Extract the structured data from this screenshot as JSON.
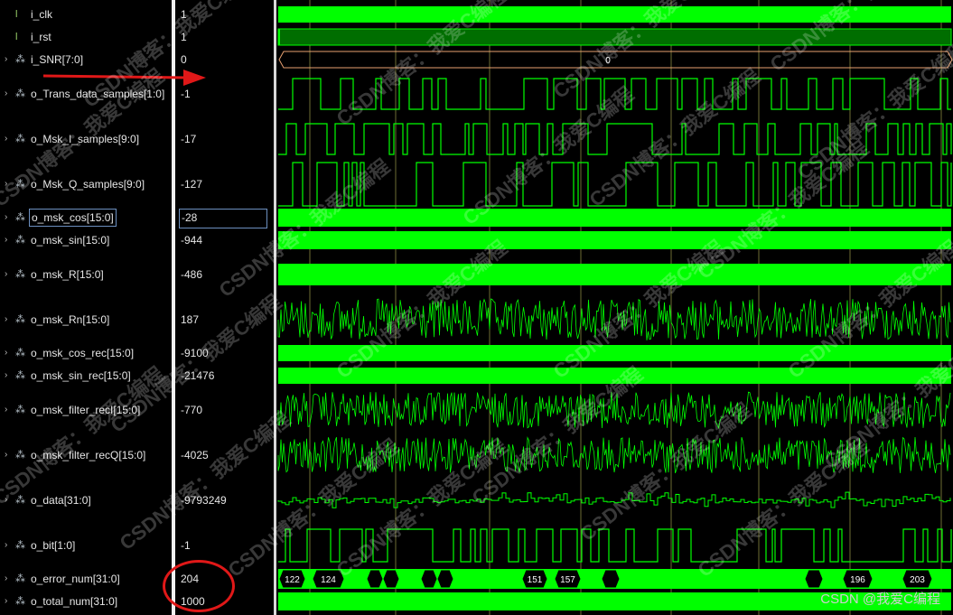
{
  "signals": [
    {
      "name": "i_clk",
      "value": "1",
      "expandable": false,
      "icon": "clock-signal-icon",
      "kind": "clk"
    },
    {
      "name": "i_rst",
      "value": "1",
      "expandable": false,
      "icon": "clock-signal-icon",
      "kind": "rst"
    },
    {
      "name": "i_SNR[7:0]",
      "value": "0",
      "expandable": true,
      "icon": "bus-icon",
      "kind": "const"
    },
    {
      "name": "o_Trans_data_samples[1:0]",
      "value": "-1",
      "expandable": true,
      "icon": "analog-bus-icon",
      "kind": "digital"
    },
    {
      "name": "o_Msk_I_samples[9:0]",
      "value": "-17",
      "expandable": true,
      "icon": "analog-bus-icon",
      "kind": "digital"
    },
    {
      "name": "o_Msk_Q_samples[9:0]",
      "value": "-127",
      "expandable": true,
      "icon": "analog-bus-icon",
      "kind": "digital"
    },
    {
      "name": "o_msk_cos[15:0]",
      "value": "-28",
      "expandable": true,
      "icon": "analog-bus-icon",
      "kind": "band",
      "selected": true
    },
    {
      "name": "o_msk_sin[15:0]",
      "value": "-944",
      "expandable": true,
      "icon": "analog-bus-icon",
      "kind": "band"
    },
    {
      "name": "o_msk_R[15:0]",
      "value": "-486",
      "expandable": true,
      "icon": "analog-bus-icon",
      "kind": "band"
    },
    {
      "name": "o_msk_Rn[15:0]",
      "value": "187",
      "expandable": true,
      "icon": "analog-bus-icon",
      "kind": "noise"
    },
    {
      "name": "o_msk_cos_rec[15:0]",
      "value": "-9100",
      "expandable": true,
      "icon": "analog-bus-icon",
      "kind": "band"
    },
    {
      "name": "o_msk_sin_rec[15:0]",
      "value": "-21476",
      "expandable": true,
      "icon": "analog-bus-icon",
      "kind": "band"
    },
    {
      "name": "o_msk_filter_recI[15:0]",
      "value": "-770",
      "expandable": true,
      "icon": "analog-bus-icon",
      "kind": "noise"
    },
    {
      "name": "o_msk_filter_recQ[15:0]",
      "value": "-4025",
      "expandable": true,
      "icon": "analog-bus-icon",
      "kind": "noise"
    },
    {
      "name": "o_data[31:0]",
      "value": "-9793249",
      "expandable": true,
      "icon": "analog-bus-icon",
      "kind": "steps"
    },
    {
      "name": "o_bit[1:0]",
      "value": "-1",
      "expandable": true,
      "icon": "analog-bus-icon",
      "kind": "digital"
    },
    {
      "name": "o_error_num[31:0]",
      "value": "204",
      "expandable": true,
      "icon": "analog-bus-icon",
      "kind": "bus"
    },
    {
      "name": "o_total_num[31:0]",
      "value": "1000",
      "expandable": true,
      "icon": "analog-bus-icon",
      "kind": "bus"
    }
  ],
  "snr_bus_label": "0",
  "error_bus_labels": [
    "122",
    "124",
    "151",
    "157",
    "196",
    "203"
  ],
  "watermark_text": "CSDN博客：我爱C编程",
  "footer_watermark": "CSDN @我爱C编程",
  "colors": {
    "wave": "#00ff00",
    "wave_dim": "#006e00",
    "bus_outline": "#e8a070",
    "grid": "#c8c860",
    "selection": "#6c8fbf",
    "annotation": "#e01818"
  }
}
